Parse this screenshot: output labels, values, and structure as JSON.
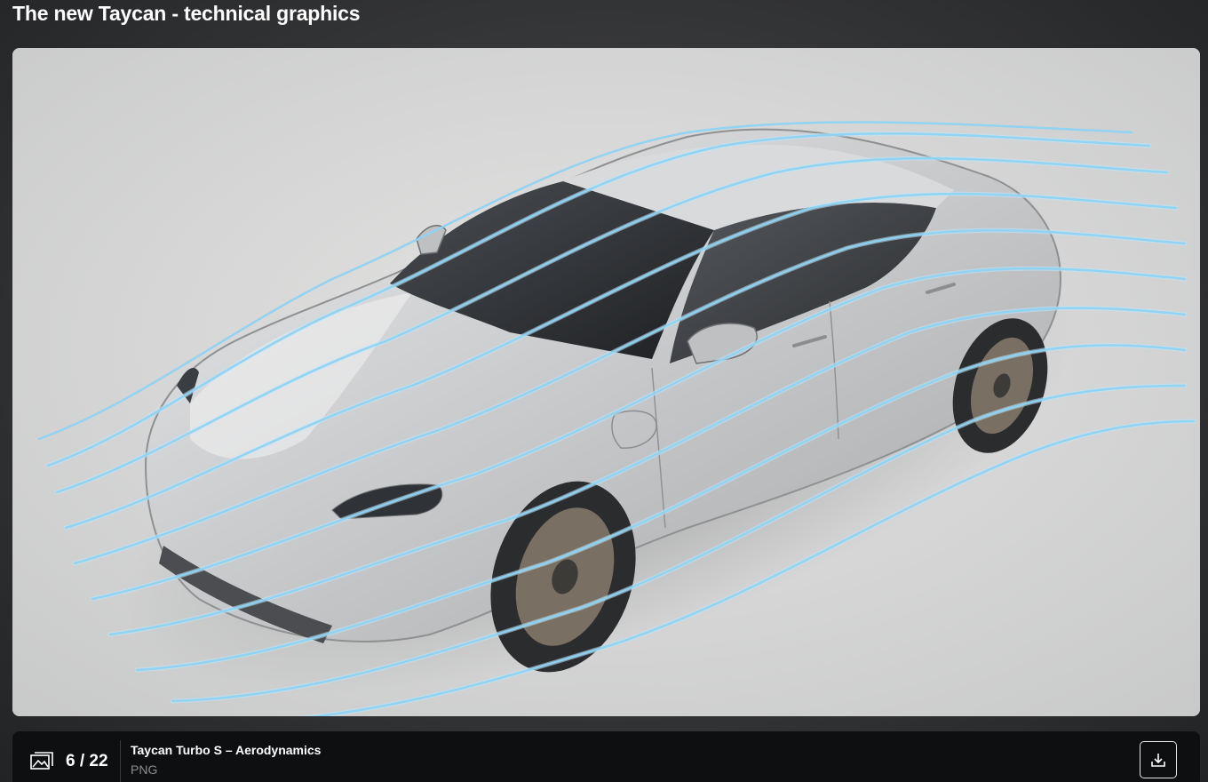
{
  "page": {
    "title": "The new Taycan - technical graphics"
  },
  "image": {
    "subject": "Taycan Turbo S – Aerodynamics",
    "icon": "gallery-icon"
  },
  "footer": {
    "counter": "6 / 22",
    "caption": "Taycan Turbo S – Aerodynamics",
    "format": "PNG",
    "download_icon": "download-icon"
  },
  "colors": {
    "background": "#3a3b3d",
    "footer_bg": "#0e0f11",
    "airflow": "#8fd3f4",
    "car_body": "#c9cacb"
  }
}
